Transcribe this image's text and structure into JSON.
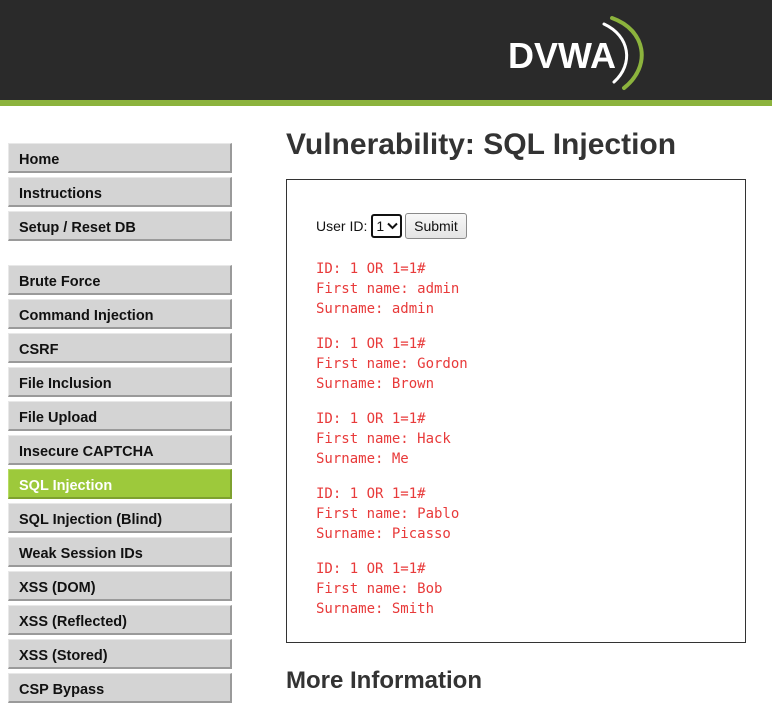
{
  "header": {
    "logo_text": "DVWA",
    "colors": {
      "background": "#2a2a2a",
      "accent": "#8cb33d"
    }
  },
  "sidebar": {
    "active_color": "#9dc93b",
    "groups": [
      [
        "Home",
        "Instructions",
        "Setup / Reset DB"
      ],
      [
        "Brute Force",
        "Command Injection",
        "CSRF",
        "File Inclusion",
        "File Upload",
        "Insecure CAPTCHA",
        "SQL Injection",
        "SQL Injection (Blind)",
        "Weak Session IDs",
        "XSS (DOM)",
        "XSS (Reflected)",
        "XSS (Stored)",
        "CSP Bypass"
      ]
    ],
    "active_item": "SQL Injection"
  },
  "main": {
    "title": "Vulnerability: SQL Injection",
    "form": {
      "label": "User ID:",
      "selected_value": "1",
      "submit_label": "Submit"
    },
    "result_color": "#e83a3a",
    "results": [
      {
        "id": "ID: 1 OR 1=1#",
        "first": "First name: admin",
        "surname": "Surname: admin"
      },
      {
        "id": "ID: 1 OR 1=1#",
        "first": "First name: Gordon",
        "surname": "Surname: Brown"
      },
      {
        "id": "ID: 1 OR 1=1#",
        "first": "First name: Hack",
        "surname": "Surname: Me"
      },
      {
        "id": "ID: 1 OR 1=1#",
        "first": "First name: Pablo",
        "surname": "Surname: Picasso"
      },
      {
        "id": "ID: 1 OR 1=1#",
        "first": "First name: Bob",
        "surname": "Surname: Smith"
      }
    ],
    "more_info_heading": "More Information"
  }
}
